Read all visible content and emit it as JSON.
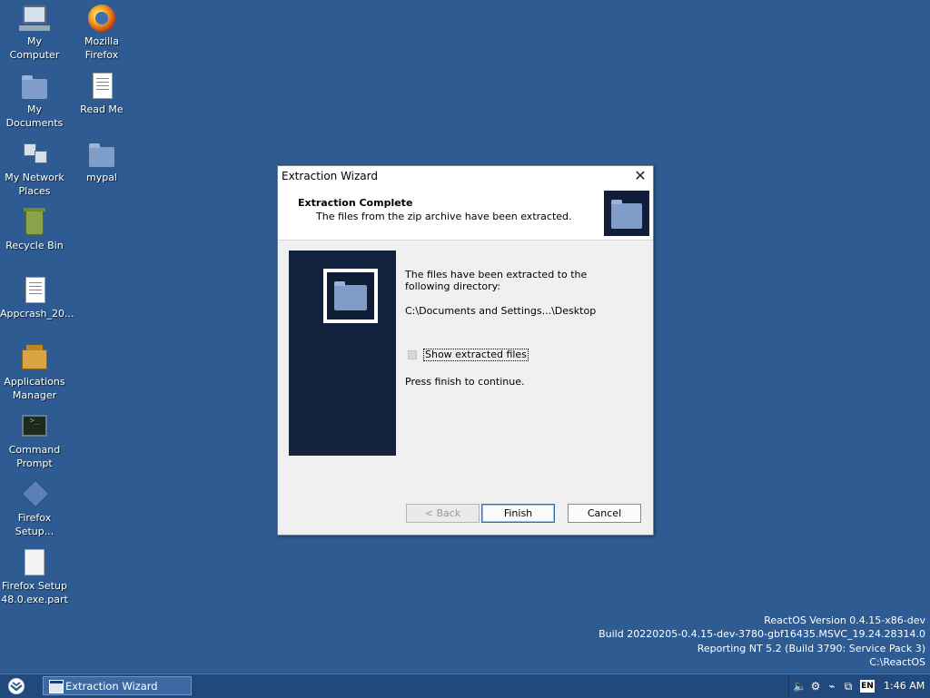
{
  "desktop": {
    "icons": [
      {
        "label": "My\nComputer",
        "icon": "my-computer-icon"
      },
      {
        "label": "Mozilla\nFirefox",
        "icon": "firefox-icon"
      },
      {
        "label": "My\nDocuments",
        "icon": "my-documents-icon"
      },
      {
        "label": "Read Me",
        "icon": "readme-document-icon"
      },
      {
        "label": "My Network\nPlaces",
        "icon": "network-places-icon"
      },
      {
        "label": "mypal",
        "icon": "folder-icon"
      },
      {
        "label": "Recycle Bin",
        "icon": "recycle-bin-icon"
      },
      {
        "label": "Appcrash_20...",
        "icon": "text-file-icon"
      },
      {
        "label": "Applications\nManager",
        "icon": "applications-manager-icon"
      },
      {
        "label": "Command\nPrompt",
        "icon": "command-prompt-icon"
      },
      {
        "label": "Firefox\nSetup...",
        "icon": "installer-icon"
      },
      {
        "label": "Firefox Setup\n48.0.exe.part",
        "icon": "partial-file-icon"
      }
    ],
    "version_info": [
      "ReactOS Version 0.4.15-x86-dev",
      "Build 20220205-0.4.15-dev-3780-gbf16435.MSVC_19.24.28314.0",
      "Reporting NT 5.2 (Build 3790: Service Pack 3)",
      "C:\\ReactOS"
    ]
  },
  "dialog": {
    "title": "Extraction Wizard",
    "header_title": "Extraction Complete",
    "header_subtitle": "The files from the zip archive have been extracted.",
    "message": "The files have been extracted to the following directory:",
    "path": "C:\\Documents and Settings...\\Desktop",
    "checkbox_label": "Show extracted files",
    "checkbox_checked": false,
    "continue_text": "Press finish to continue.",
    "buttons": {
      "back": "< Back",
      "finish": "Finish",
      "cancel": "Cancel"
    }
  },
  "taskbar": {
    "active_window": "Extraction Wizard",
    "language": "EN",
    "clock": "1:46 AM"
  },
  "colors": {
    "desktop": "#2d5b92",
    "taskbar": "#22497b",
    "wizard_panel": "#12223f"
  }
}
